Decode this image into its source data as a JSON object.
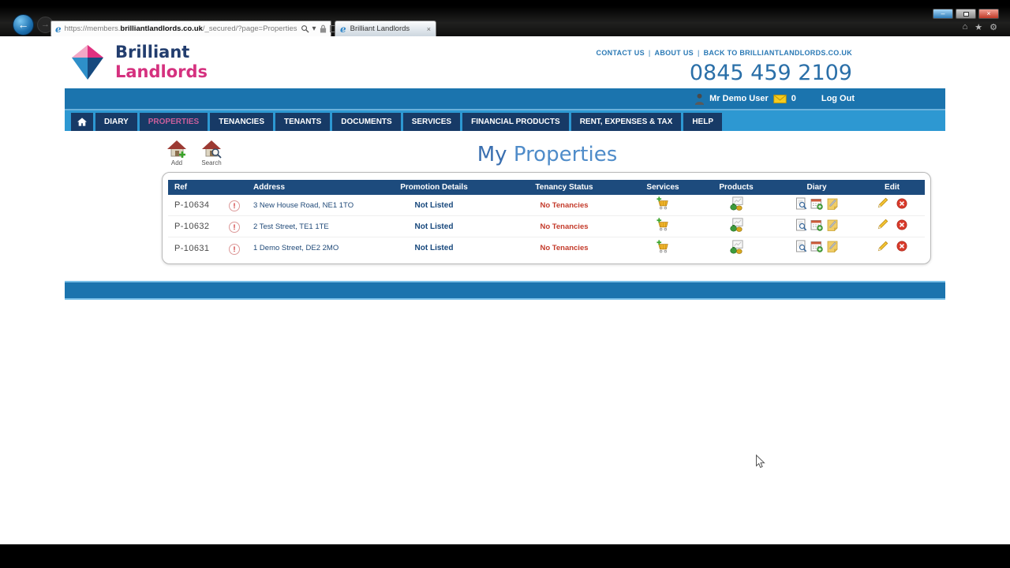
{
  "browser": {
    "tab_title": "Brilliant Landlords",
    "url_prefix": "https://members.",
    "url_domain": "brilliantlandlords.co.uk",
    "url_suffix": "/_secured/?page=Properties",
    "glyphs": {
      "back": "←",
      "forward": "→",
      "minimize": "–",
      "close": "×",
      "dropdown": "▾",
      "refresh": "↻",
      "stop": "×",
      "home": "⌂",
      "star": "★",
      "gear": "⚙",
      "favicon": "e",
      "tab_close": "×"
    }
  },
  "header": {
    "brand_line1": "Brilliant",
    "brand_line2": "Landlords",
    "links": [
      "CONTACT US",
      "ABOUT US",
      "BACK TO BRILLIANTLANDLORDS.CO.UK"
    ],
    "link_separator": "|",
    "phone": "0845 459 2109"
  },
  "user_bar": {
    "user_name": "Mr Demo User",
    "message_count": "0",
    "logout_label": "Log Out"
  },
  "nav": {
    "items": [
      "DIARY",
      "PROPERTIES",
      "TENANCIES",
      "TENANTS",
      "DOCUMENTS",
      "SERVICES",
      "FINANCIAL PRODUCTS",
      "RENT, EXPENSES & TAX",
      "HELP"
    ],
    "active": "PROPERTIES"
  },
  "toolbar": {
    "add_label": "Add",
    "search_label": "Search"
  },
  "page": {
    "title_word1": "My",
    "title_word2": "Properties"
  },
  "table": {
    "headers": {
      "ref": "Ref",
      "address": "Address",
      "promotion": "Promotion Details",
      "tenancy": "Tenancy Status",
      "services": "Services",
      "products": "Products",
      "diary": "Diary",
      "edit": "Edit"
    },
    "alert_glyph": "!",
    "rows": [
      {
        "ref": "P-10634",
        "address": "3 New House Road, NE1 1TO",
        "promotion": "Not Listed",
        "tenancy": "No Tenancies"
      },
      {
        "ref": "P-10632",
        "address": "2 Test Street, TE1 1TE",
        "promotion": "Not Listed",
        "tenancy": "No Tenancies"
      },
      {
        "ref": "P-10631",
        "address": "1 Demo Street, DE2 2MO",
        "promotion": "Not Listed",
        "tenancy": "No Tenancies"
      }
    ]
  },
  "colors": {
    "primary_blue": "#1b74ae",
    "light_blue": "#2d98d2",
    "navy_header": "#1d4b7d",
    "brand_pink": "#d5317f",
    "alert_red": "#c43b2b"
  }
}
